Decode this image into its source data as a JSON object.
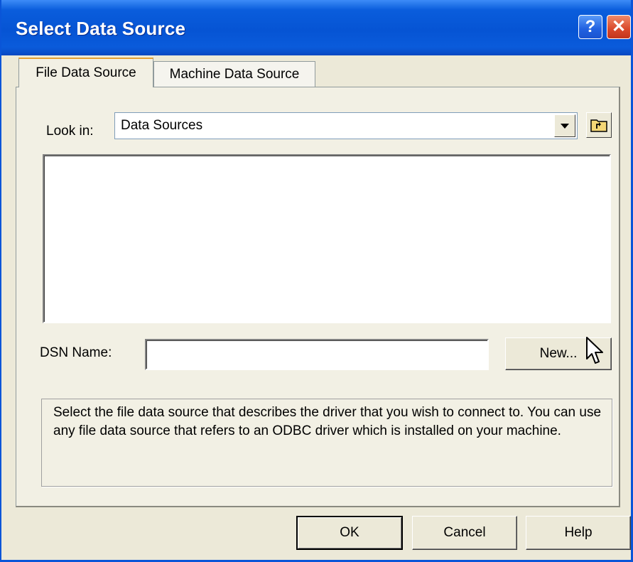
{
  "window": {
    "title": "Select Data Source",
    "help_glyph": "?",
    "close_glyph": "✕"
  },
  "tabs": [
    {
      "label": "File Data Source",
      "active": true
    },
    {
      "label": "Machine Data Source",
      "active": false
    }
  ],
  "look_in": {
    "label": "Look in:",
    "value": "Data Sources"
  },
  "dsn": {
    "label": "DSN Name:",
    "value": ""
  },
  "buttons": {
    "new": "New...",
    "ok": "OK",
    "cancel": "Cancel",
    "help": "Help"
  },
  "description": "Select the file data source that describes the driver that you wish to connect to. You can use any file data source that refers to an ODBC driver which is installed on your machine.",
  "icons": {
    "up_folder": "up-one-level-folder-icon",
    "dropdown": "chevron-down-icon",
    "cursor": "mouse-pointer-icon"
  },
  "colors": {
    "titlebar": "#0654d4",
    "face": "#ece9d8",
    "tab_highlight": "#e6a032"
  }
}
